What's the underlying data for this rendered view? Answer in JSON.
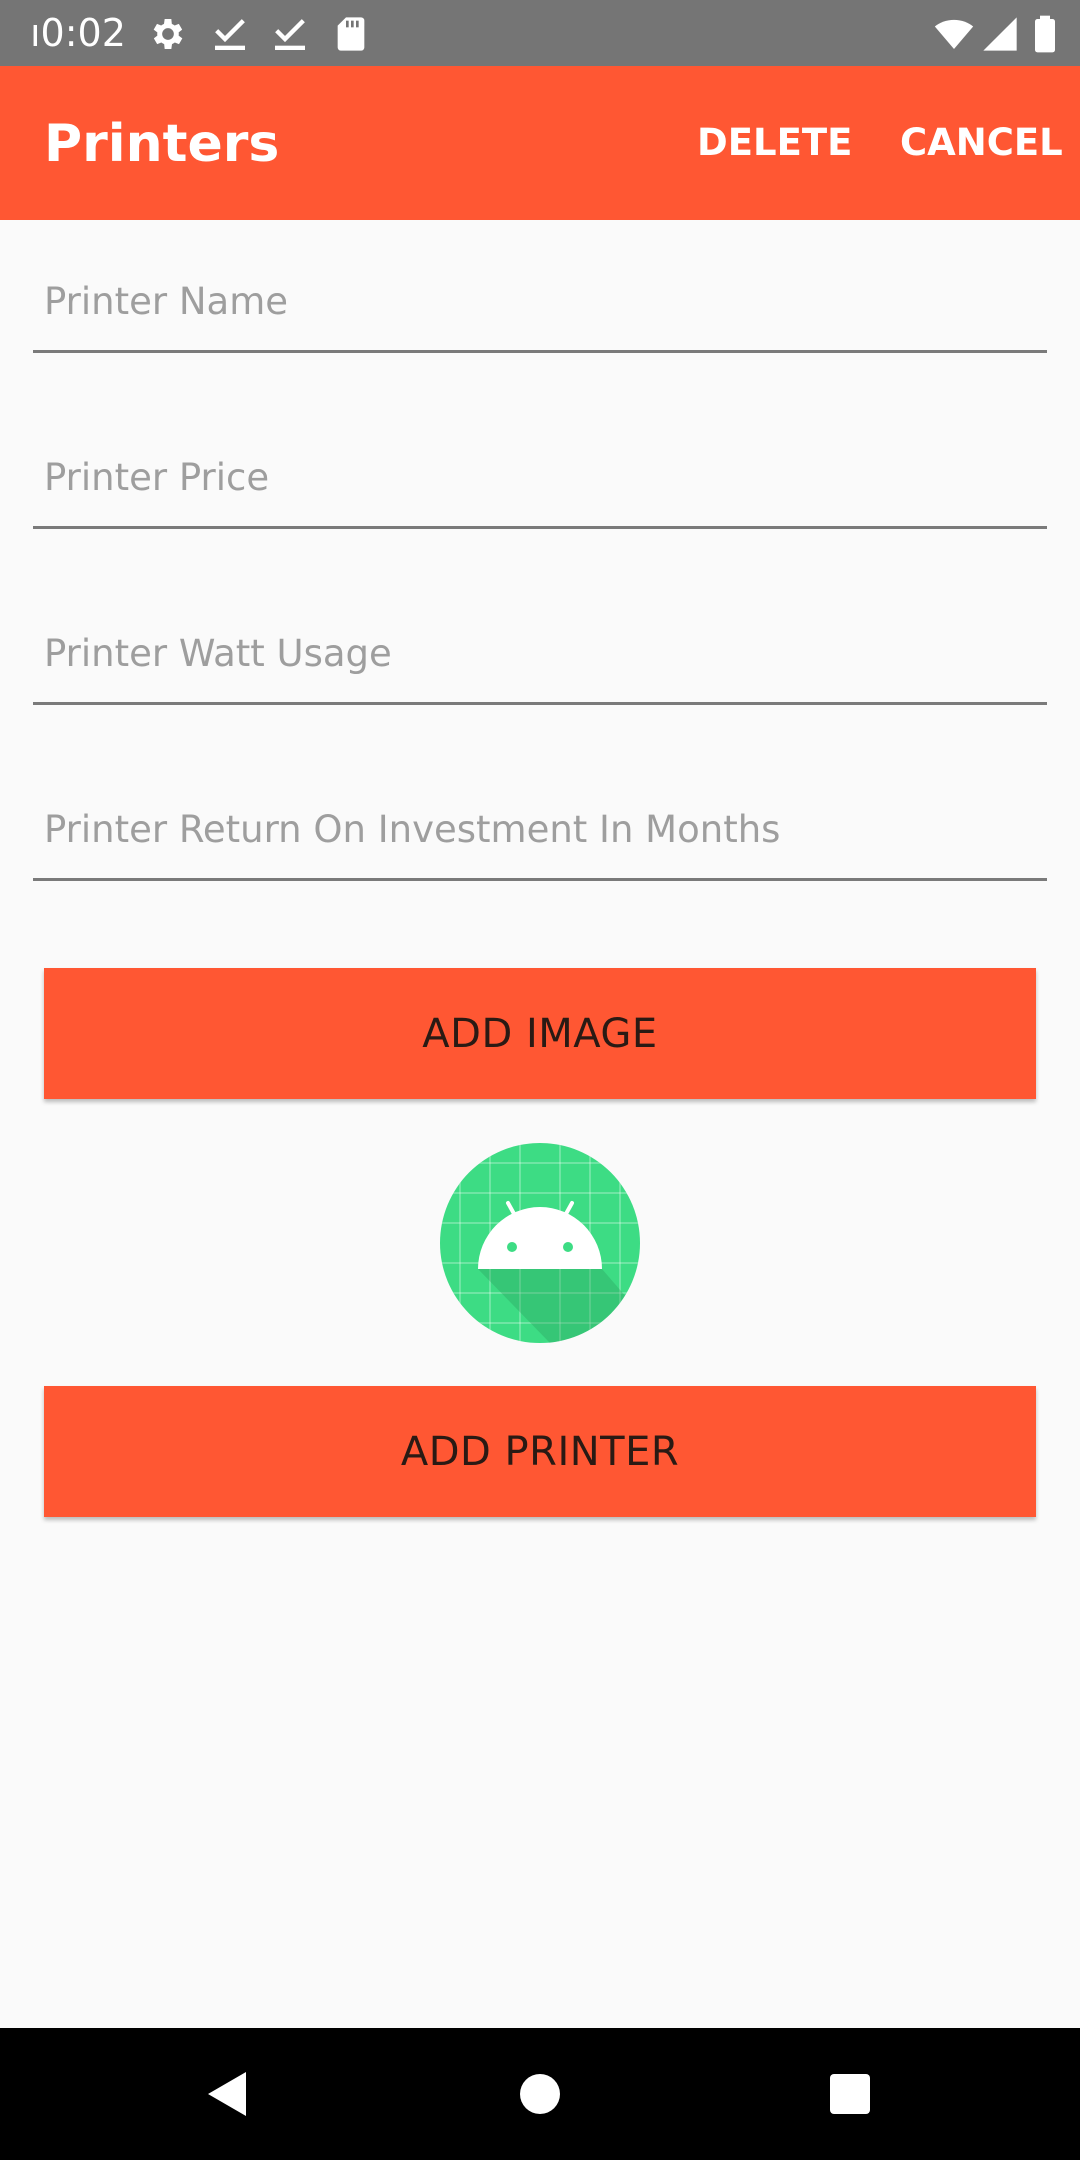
{
  "status_bar": {
    "time": "ı0:02",
    "left_icons": [
      "gear-icon",
      "download-check-icon",
      "download-check-icon",
      "sd-card-icon"
    ],
    "right_icons": [
      "wifi-icon",
      "cell-signal-icon",
      "battery-icon"
    ]
  },
  "app_bar": {
    "title": "Printers",
    "delete_label": "DELETE",
    "cancel_label": "CANCEL"
  },
  "form": {
    "printer_name": {
      "value": "",
      "placeholder": "Printer Name"
    },
    "printer_price": {
      "value": "",
      "placeholder": "Printer Price"
    },
    "printer_watt_usage": {
      "value": "",
      "placeholder": "Printer Watt Usage"
    },
    "printer_roi": {
      "value": "",
      "placeholder": "Printer Return On Investment In Months"
    }
  },
  "buttons": {
    "add_image_label": "ADD IMAGE",
    "add_printer_label": "ADD PRINTER"
  },
  "image_preview": {
    "icon": "android-icon"
  },
  "nav_bar": {
    "buttons": [
      "back-icon",
      "home-icon",
      "recents-icon"
    ]
  },
  "colors": {
    "accent": "#FF5733",
    "status_bar": "#757575",
    "background": "#FAFAFA",
    "nav_bar": "#000000",
    "android_green": "#3DDC84"
  }
}
